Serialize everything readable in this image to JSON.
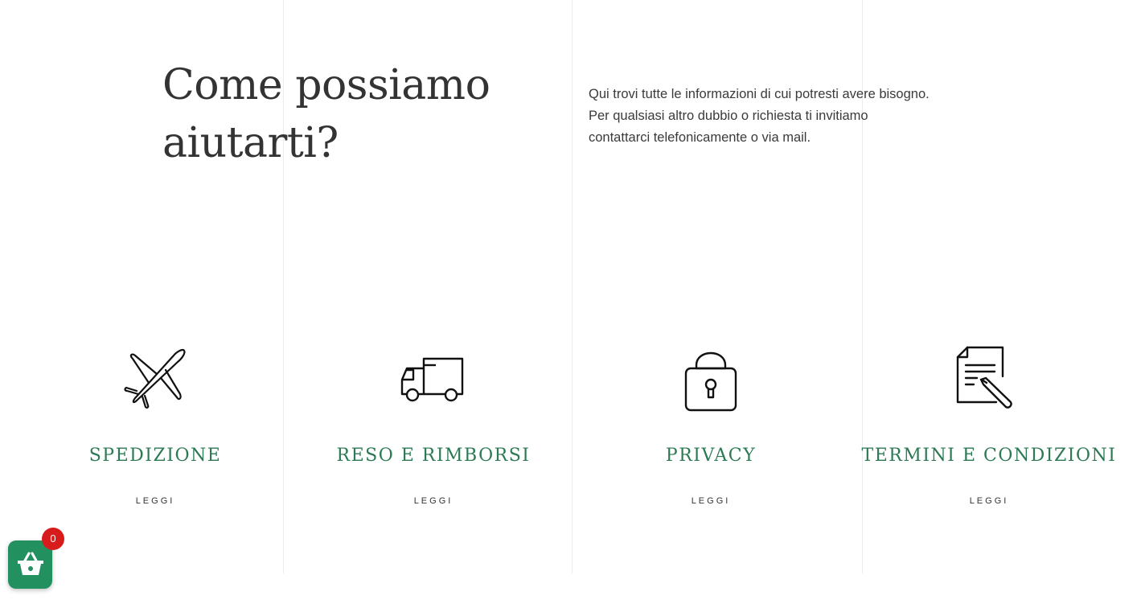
{
  "header": {
    "heading_line1": "Come possiamo",
    "heading_line2": "aiutarti?",
    "intro_line1": "Qui trovi tutte le informazioni di cui potresti avere bisogno.",
    "intro_line2": "Per qualsiasi altro dubbio o richiesta ti invitiamo",
    "intro_line3": "contattarci telefonicamente o via mail."
  },
  "cards": [
    {
      "title": "SPEDIZIONE",
      "button": "LEGGI",
      "icon": "airplane-icon"
    },
    {
      "title": "RESO E RIMBORSI",
      "button": "LEGGI",
      "icon": "truck-icon"
    },
    {
      "title": "PRIVACY",
      "button": "LEGGI",
      "icon": "padlock-icon"
    },
    {
      "title": "TERMINI E CONDIZIONI",
      "button": "LEGGI",
      "icon": "document-pen-icon"
    }
  ],
  "cart": {
    "count": "0",
    "icon": "basket-icon"
  },
  "colors": {
    "accent": "#2c7a54",
    "cart_bg": "#23915f",
    "badge": "#d81b1b",
    "highlight": "#d6ede0"
  }
}
